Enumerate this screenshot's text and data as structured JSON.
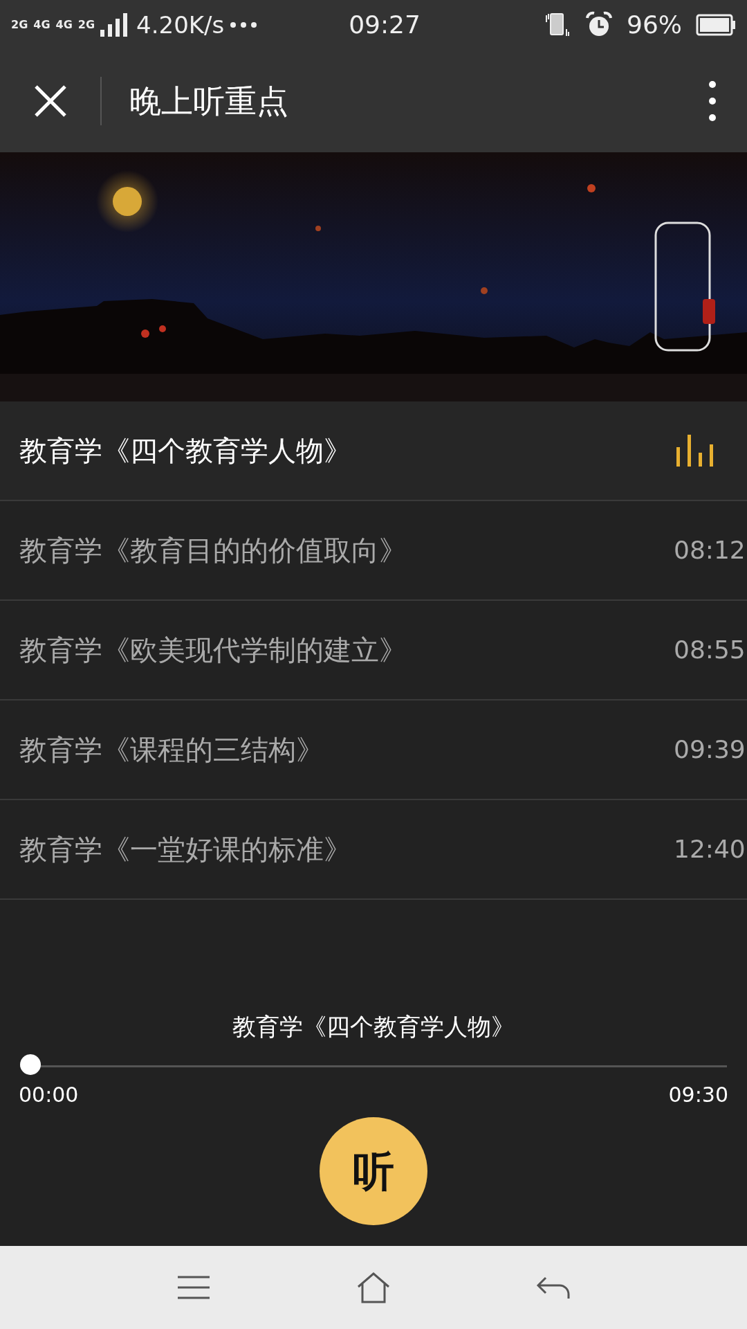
{
  "status_bar": {
    "signal_labels": [
      "2G",
      "4G",
      "4G",
      "2G"
    ],
    "speed": "4.20K/s",
    "time": "09:27",
    "battery": "96%"
  },
  "title_bar": {
    "title": "晚上听重点"
  },
  "playlist": [
    {
      "title": "教育学《四个教育学人物》",
      "playing": true
    },
    {
      "title": "教育学《教育目的的价值取向》",
      "duration": "08:12",
      "playing": false
    },
    {
      "title": "教育学《欧美现代学制的建立》",
      "duration": "08:55",
      "playing": false
    },
    {
      "title": "教育学《课程的三结构》",
      "duration": "09:39",
      "playing": false
    },
    {
      "title": "教育学《一堂好课的标准》",
      "duration": "12:40",
      "playing": false
    }
  ],
  "player": {
    "title": "教育学《四个教育学人物》",
    "level": 0,
    "elapsed": "00:00",
    "total": "09:30",
    "button": "听"
  }
}
